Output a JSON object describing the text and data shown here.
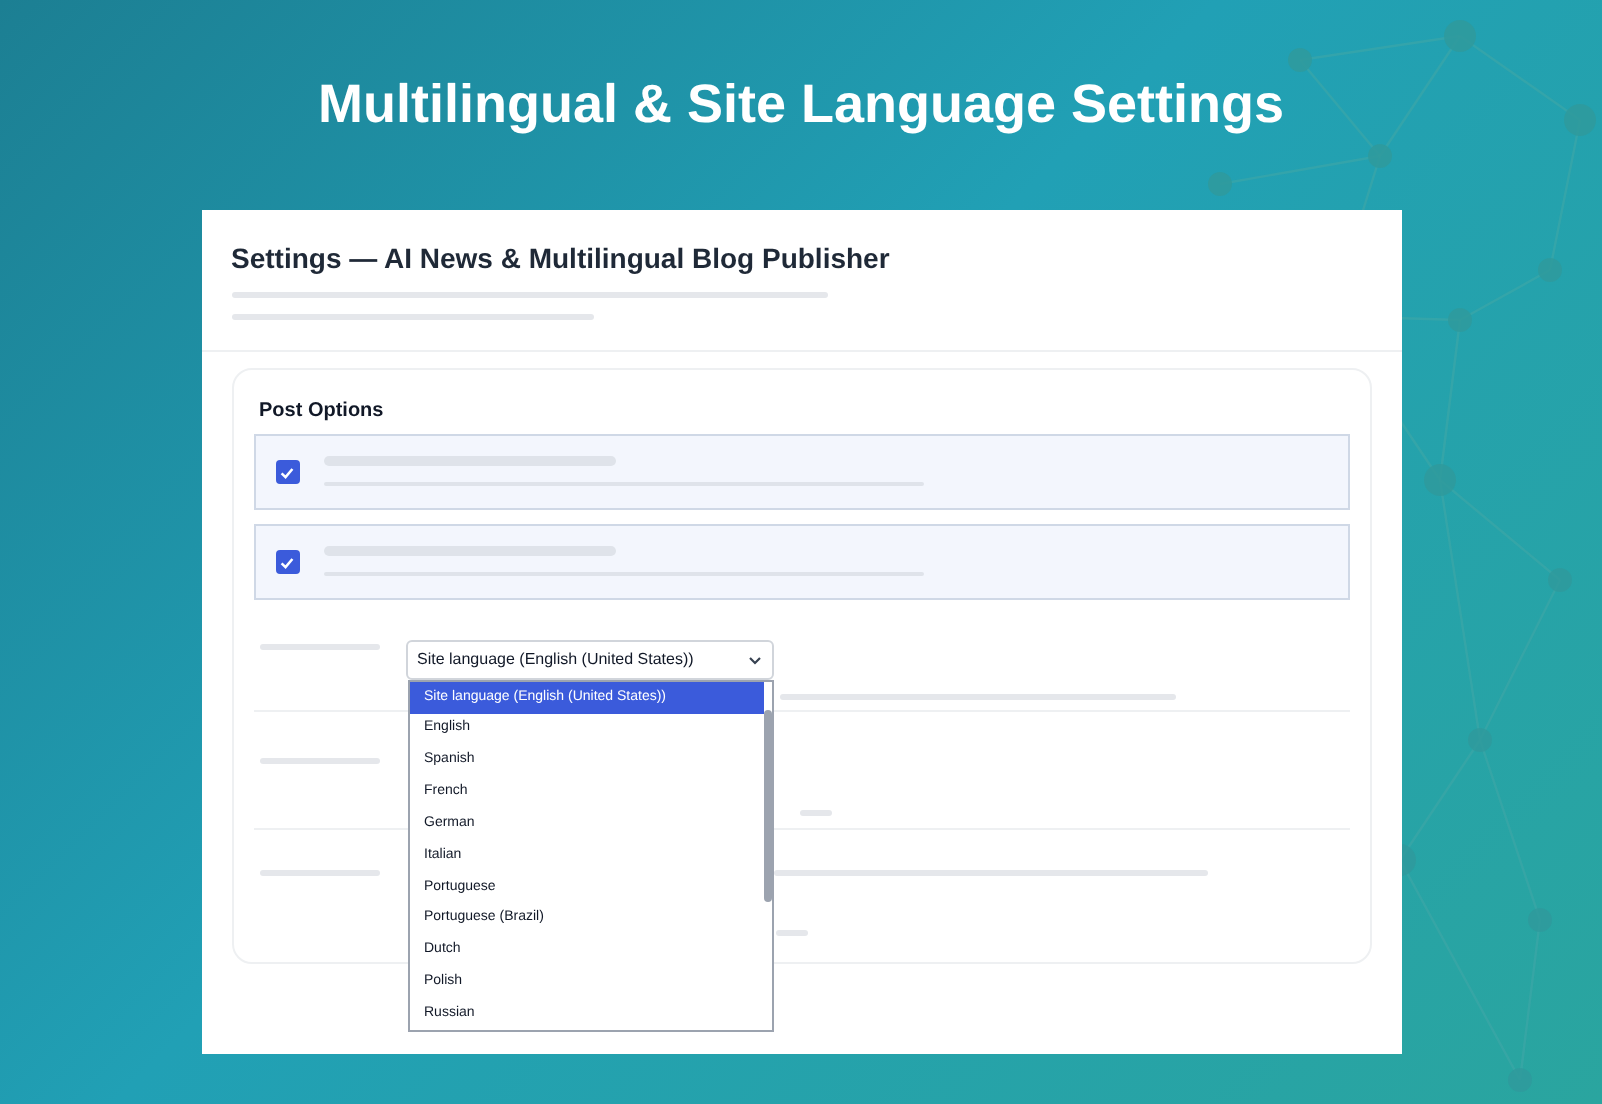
{
  "banner": {
    "title": "Multilingual & Site Language Settings"
  },
  "settings": {
    "title": "Settings — AI News & Multilingual Blog Publisher"
  },
  "post_options": {
    "title": "Post Options",
    "options": [
      {
        "checked": true
      },
      {
        "checked": true
      }
    ]
  },
  "language_select": {
    "value": "Site language (English (United States))",
    "options": [
      {
        "label": "Site language (English (United States))",
        "selected": true
      },
      {
        "label": "English",
        "selected": false
      },
      {
        "label": "Spanish",
        "selected": false
      },
      {
        "label": "French",
        "selected": false
      },
      {
        "label": "German",
        "selected": false
      },
      {
        "label": "Italian",
        "selected": false
      },
      {
        "label": "Portuguese",
        "selected": false
      },
      {
        "label": "Portuguese (Brazil)",
        "selected": false
      },
      {
        "label": "Dutch",
        "selected": false
      },
      {
        "label": "Polish",
        "selected": false
      },
      {
        "label": "Russian",
        "selected": false
      }
    ]
  }
}
